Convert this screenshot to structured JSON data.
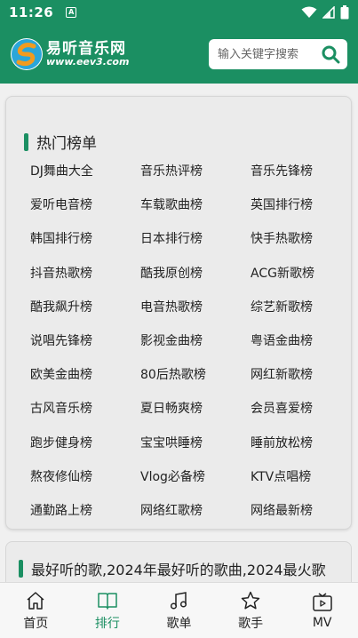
{
  "status_bar": {
    "time": "11:26",
    "notif": "A"
  },
  "header": {
    "logo_name": "易听音乐网",
    "logo_url": "www.eev3.com",
    "search_placeholder": "输入关键字搜索"
  },
  "hot_charts": {
    "title": "热门榜单",
    "items": [
      "DJ舞曲大全",
      "音乐热评榜",
      "音乐先锋榜",
      "爱听电音榜",
      "车载歌曲榜",
      "英国排行榜",
      "韩国排行榜",
      "日本排行榜",
      "快手热歌榜",
      "抖音热歌榜",
      "酷我原创榜",
      "ACG新歌榜",
      "酷我飙升榜",
      "电音热歌榜",
      "综艺新歌榜",
      "说唱先锋榜",
      "影视金曲榜",
      "粤语金曲榜",
      "欧美金曲榜",
      "80后热歌榜",
      "网红新歌榜",
      "古风音乐榜",
      "夏日畅爽榜",
      "会员喜爱榜",
      "跑步健身榜",
      "宝宝哄睡榜",
      "睡前放松榜",
      "熬夜修仙榜",
      "Vlog必备榜",
      "KTV点唱榜",
      "通勤路上榜",
      "网络红歌榜",
      "网络最新榜"
    ]
  },
  "second_card": {
    "title": "最好听的歌,2024年最好听的歌曲,2024最火歌"
  },
  "nav": {
    "items": [
      {
        "label": "首页",
        "icon": "home-icon"
      },
      {
        "label": "排行",
        "icon": "book-icon"
      },
      {
        "label": "歌单",
        "icon": "music-note-icon"
      },
      {
        "label": "歌手",
        "icon": "star-icon"
      },
      {
        "label": "MV",
        "icon": "video-icon"
      }
    ],
    "active": "排行"
  },
  "colors": {
    "brand": "#1b8f62",
    "background": "#f0f0f0"
  }
}
